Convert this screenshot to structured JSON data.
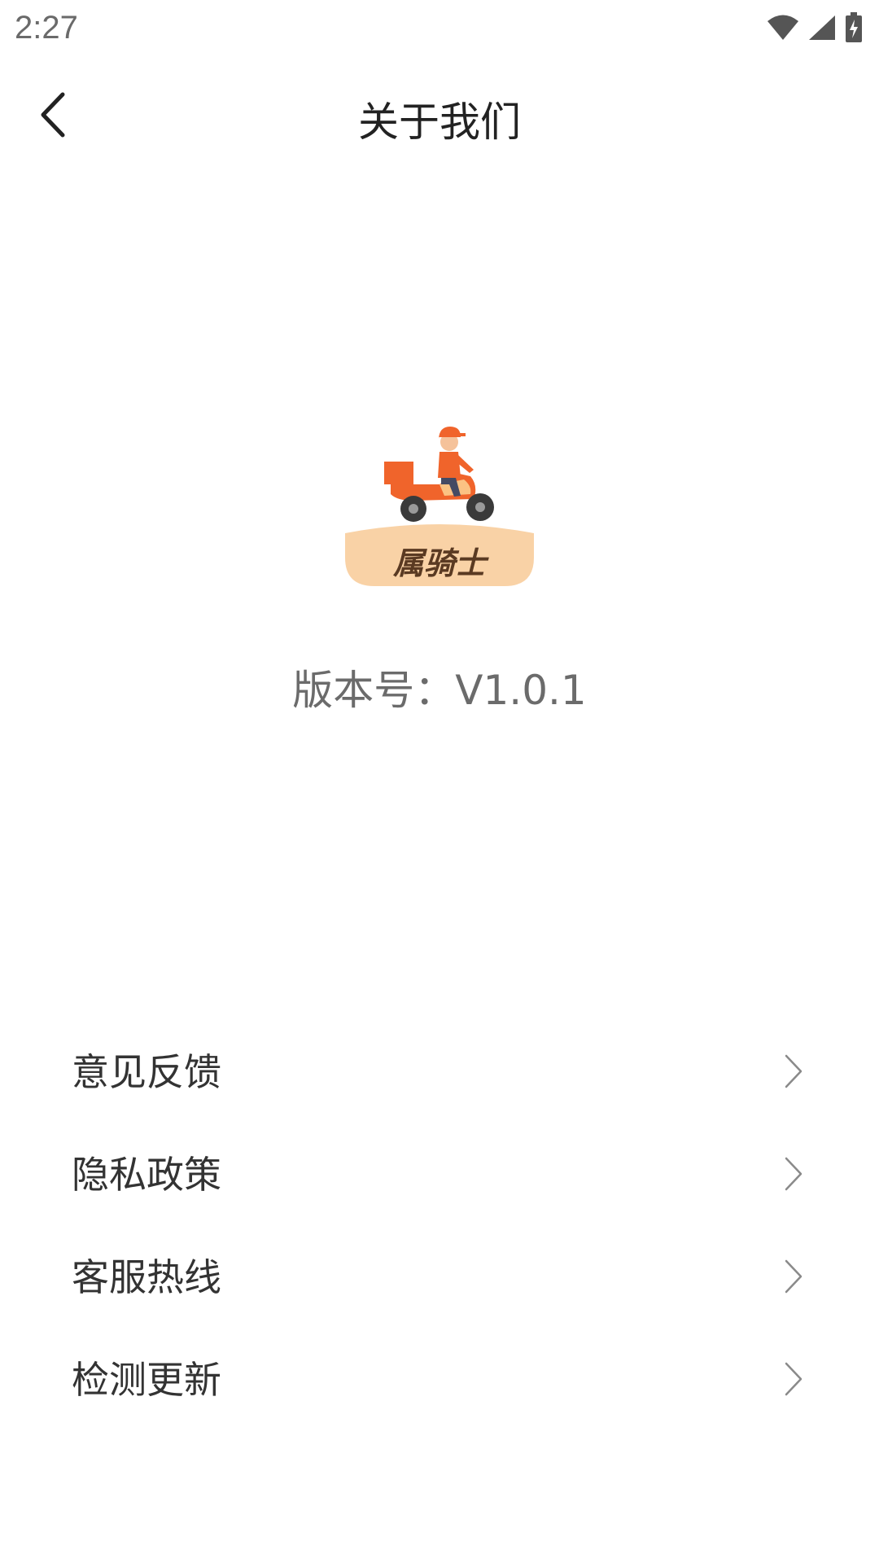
{
  "status_bar": {
    "time": "2:27",
    "icons": [
      "wifi-icon",
      "cell-signal-icon",
      "battery-charging-icon"
    ]
  },
  "header": {
    "back_icon": "chevron-left-icon",
    "title": "关于我们"
  },
  "logo": {
    "text": "属骑士",
    "colors": {
      "orange": "#F0642B",
      "light_orange": "#FBC283",
      "banner": "#F9D2A6"
    }
  },
  "version_text": "版本号：V1.0.1",
  "menu": {
    "items": [
      {
        "label": "意见反馈",
        "icon": "chevron-right-icon"
      },
      {
        "label": "隐私政策",
        "icon": "chevron-right-icon"
      },
      {
        "label": "客服热线",
        "icon": "chevron-right-icon"
      },
      {
        "label": "检测更新",
        "icon": "chevron-right-icon"
      }
    ]
  }
}
